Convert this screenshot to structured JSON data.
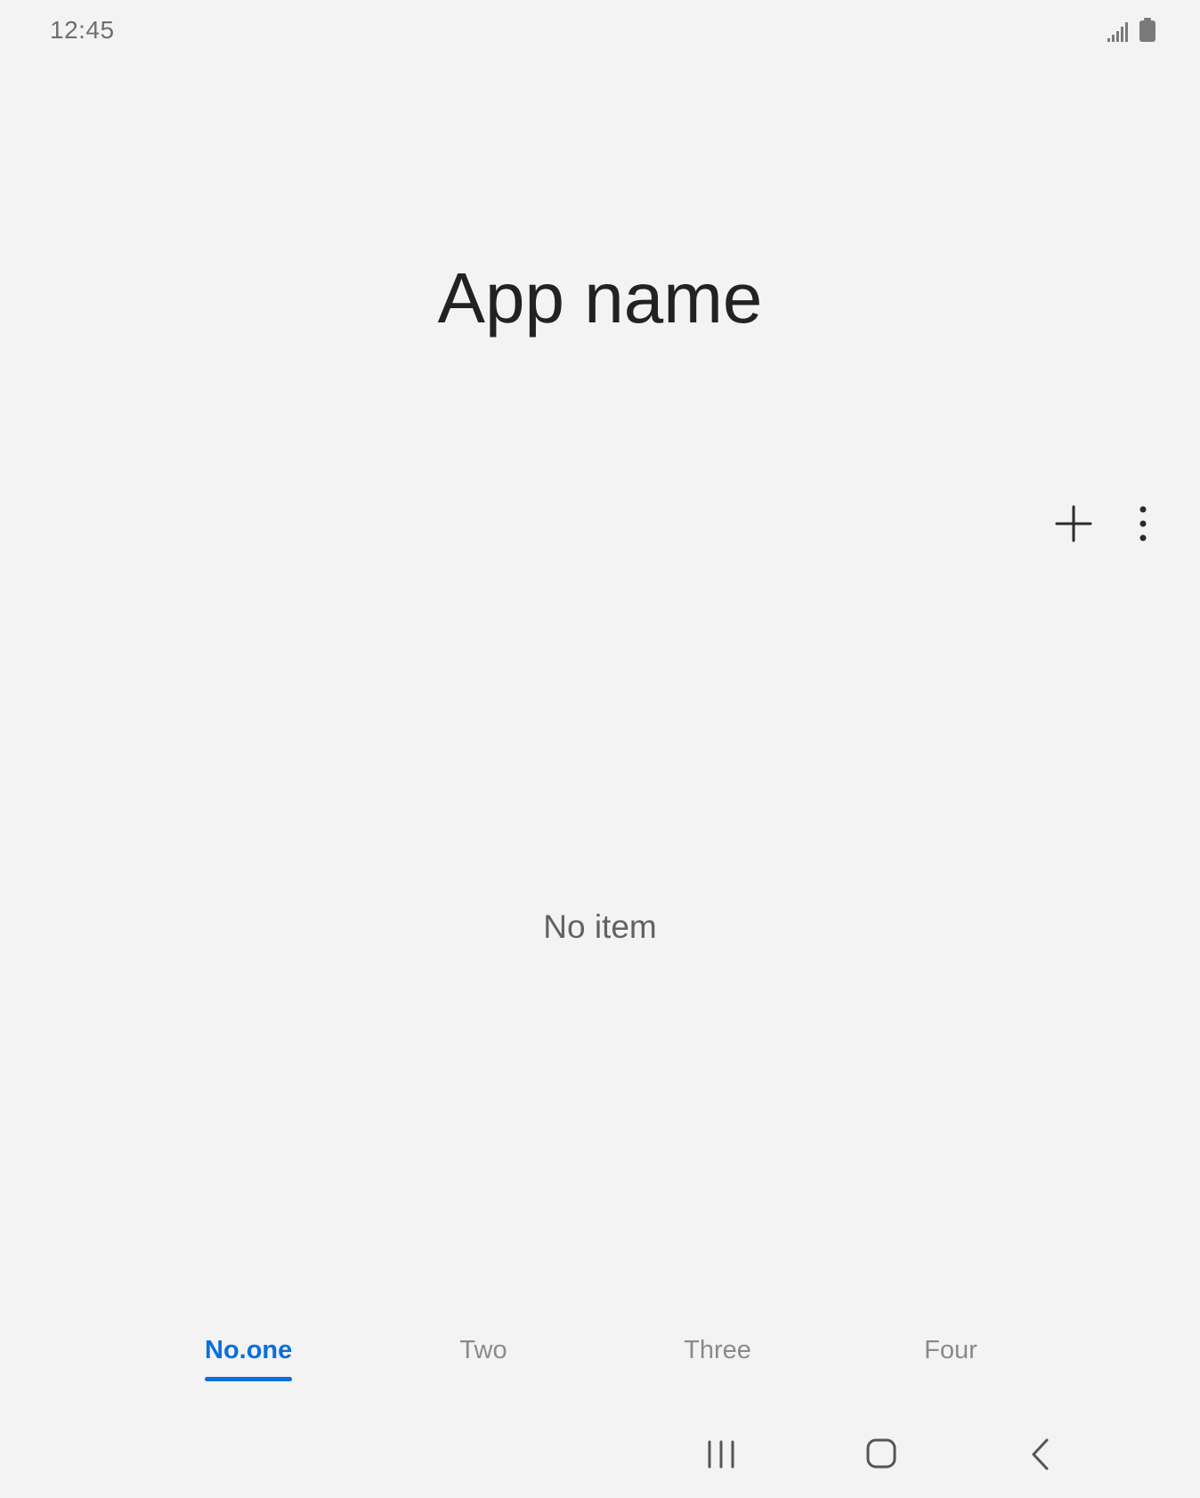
{
  "status_bar": {
    "time": "12:45",
    "icons": [
      "signal-icon",
      "battery-icon"
    ]
  },
  "header": {
    "title": "App name"
  },
  "toolbar": {
    "actions": [
      "add-icon",
      "more-vert-icon"
    ]
  },
  "main": {
    "empty_text": "No item"
  },
  "tabs": [
    {
      "label": "No.one",
      "active": true
    },
    {
      "label": "Two",
      "active": false
    },
    {
      "label": "Three",
      "active": false
    },
    {
      "label": "Four",
      "active": false
    }
  ],
  "nav_bar": {
    "buttons": [
      "recents-icon",
      "home-icon",
      "back-icon"
    ]
  },
  "colors": {
    "background": "#f3f3f3",
    "accent": "#0b6fdb",
    "title": "#222222",
    "inactive_tab": "#8a8a8a"
  }
}
